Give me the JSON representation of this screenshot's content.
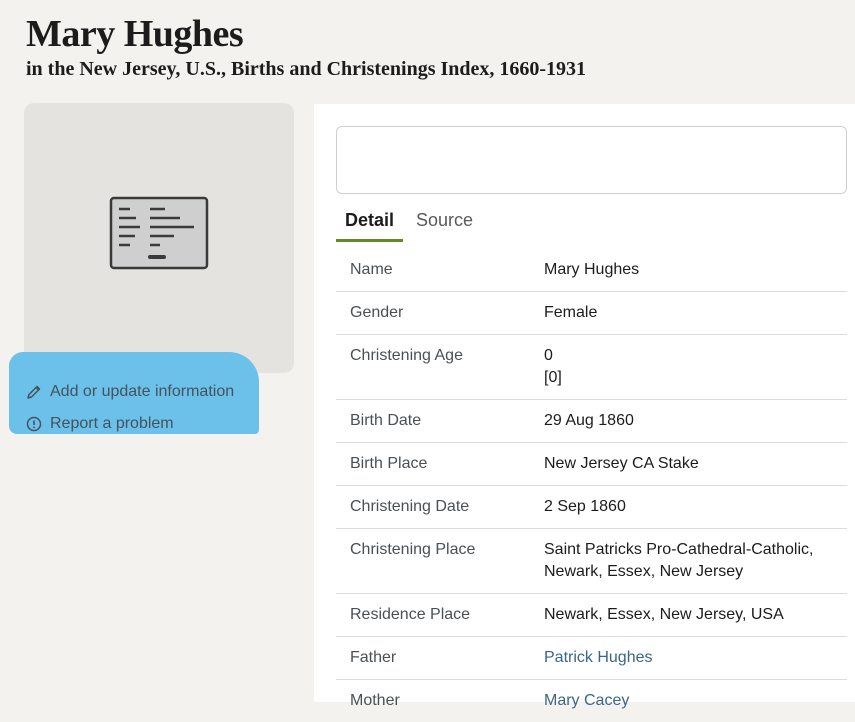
{
  "page": {
    "title": "Mary Hughes",
    "subtitle": "in the New Jersey, U.S., Births and Christenings Index, 1660-1931"
  },
  "sidebar": {
    "add_update_label": "Add or update information",
    "report_problem_label": "Report a problem",
    "highlight_color": "#6cc1ea"
  },
  "tabs": [
    {
      "label": "Detail",
      "active": true
    },
    {
      "label": "Source",
      "active": false
    }
  ],
  "details": [
    {
      "label": "Name",
      "value": "Mary Hughes"
    },
    {
      "label": "Gender",
      "value": "Female"
    },
    {
      "label": "Christening Age",
      "value": "0",
      "value2": "[0]"
    },
    {
      "label": "Birth Date",
      "value": "29 Aug 1860"
    },
    {
      "label": "Birth Place",
      "value": "New Jersey CA Stake"
    },
    {
      "label": "Christening Date",
      "value": "2 Sep 1860"
    },
    {
      "label": "Christening Place",
      "value": "Saint Patricks Pro-Cathedral-Catholic,",
      "value2": "Newark, Essex, New Jersey"
    },
    {
      "label": "Residence Place",
      "value": "Newark, Essex, New Jersey, USA"
    },
    {
      "label": "Father",
      "value": "Patrick Hughes"
    },
    {
      "label": "Mother",
      "value": "Mary Cacey"
    }
  ],
  "colors": {
    "accent_tab": "#5f8a2a",
    "link": "#3b6688"
  }
}
